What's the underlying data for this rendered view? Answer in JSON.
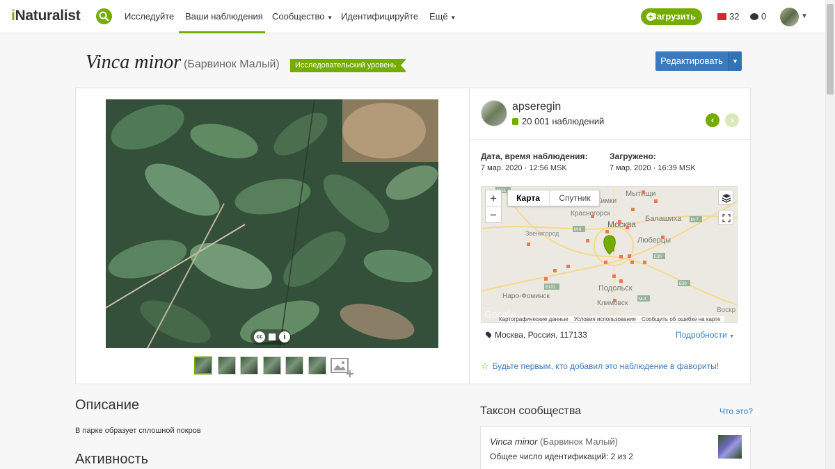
{
  "nav": {
    "logo_i": "i",
    "logo_rest": "Naturalist",
    "explore": "Исследуйте",
    "your_obs": "Ваши наблюдения",
    "community": "Сообщество",
    "identify": "Идентифицируйте",
    "more": "Ещё",
    "upload": "Загрузить",
    "mail_count": "32",
    "chat_count": "0"
  },
  "header": {
    "scientific_name": "Vinca minor",
    "common_name": "(Барвинок Малый)",
    "quality_grade": "Исследовательский уровень",
    "edit_label": "Редактировать"
  },
  "observer": {
    "username": "apseregin",
    "observations": "20 001 наблюдений"
  },
  "dates": {
    "observed_label": "Дата, время наблюдения:",
    "observed_value": "7 мар. 2020 · 12:56 MSK",
    "uploaded_label": "Загружено:",
    "uploaded_value": "7 мар. 2020 · 16:39 MSK"
  },
  "map": {
    "map_label": "Карта",
    "satellite_label": "Спутник",
    "footer_data": "Картографические данные",
    "footer_terms": "Условия использования",
    "footer_report": "Сообщить об ошибке на карте",
    "cities": [
      "Мытищи",
      "Химки",
      "Красногорск",
      "Москва",
      "Балашиха",
      "Звенигород",
      "Люберцы",
      "Подольск",
      "Наро-Фоминск",
      "Климовск",
      "Воскр"
    ],
    "road_labels": [
      "M-11",
      "M-9",
      "M-7",
      "E30",
      "E101",
      "M-4"
    ],
    "watermark": "Google",
    "place": "Москва, Россия, 117133",
    "details": "Подробности"
  },
  "fave": "Будьте первым, кто добавил это наблюдение в фавориты!",
  "description": {
    "heading": "Описание",
    "text": "В парке образует сплошной покров"
  },
  "activity": {
    "heading": "Активность"
  },
  "community_taxon": {
    "heading": "Таксон сообщества",
    "whats_this": "Что это?",
    "scientific": "Vinca minor",
    "common": "(Барвинок Малый)",
    "ids": "Общее число идентификаций: 2 из 2"
  },
  "colors": {
    "brand_green": "#74ac00",
    "link_blue": "#3a7bbf",
    "mail_red": "#d9252b"
  },
  "icons": [
    "search-icon",
    "plus-icon",
    "mail-icon",
    "chat-icon",
    "binoculars-icon",
    "pin-icon",
    "star-icon",
    "layers-icon",
    "fullscreen-icon",
    "cc-icon",
    "flag-icon",
    "info-icon",
    "add-photo-icon"
  ]
}
